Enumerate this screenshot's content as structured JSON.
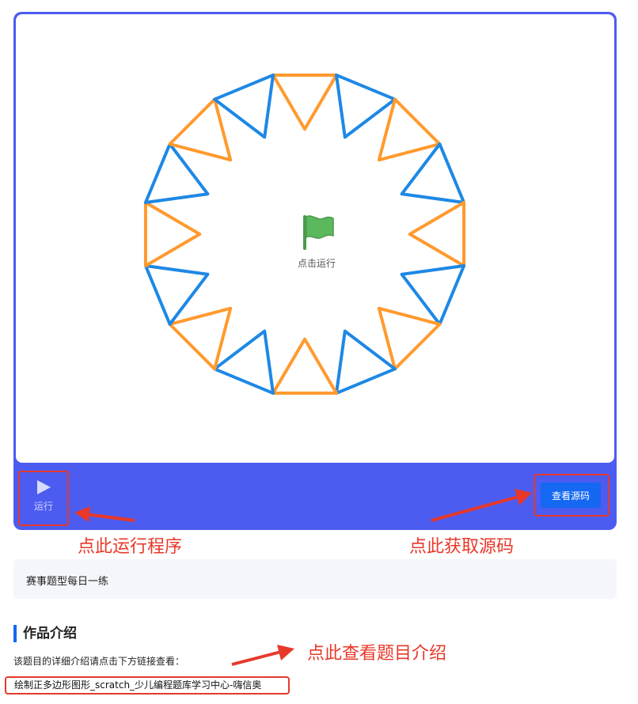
{
  "player": {
    "flag_label": "点击运行",
    "run_label": "运行",
    "source_button": "查看源码",
    "stage_colors": {
      "blue": "#1e88e5",
      "orange": "#ff9a2e",
      "flag": "#5cb85c"
    },
    "icons": [
      "green-flag-icon",
      "play-icon"
    ]
  },
  "annotations": {
    "run_hint": "点此运行程序",
    "source_hint": "点此获取源码",
    "intro_hint": "点此查看题目介绍"
  },
  "tag": {
    "text": "赛事题型每日一练"
  },
  "intro": {
    "title": "作品介绍",
    "description": "该题目的详细介绍请点击下方链接查看：",
    "link_text": "绘制正多边形图形_scratch_少儿编程题库学习中心-嗨信奥"
  }
}
